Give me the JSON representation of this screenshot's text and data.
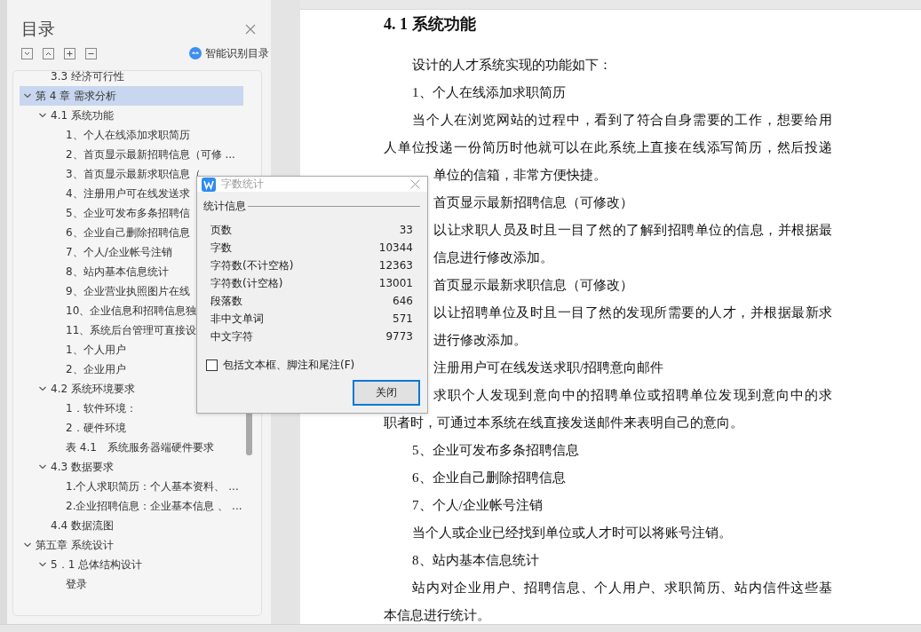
{
  "toc_panel": {
    "title": "目录",
    "smart_button": "智能识别目录",
    "tree": [
      {
        "label": "3.3 经济可行性",
        "kind": "orphan",
        "selected": false
      },
      {
        "label": "第 4 章  需求分析",
        "selected": true,
        "expanded": true,
        "children": [
          {
            "label": "4.1 系统功能",
            "selected": false,
            "expanded": true,
            "children": [
              {
                "label": "1、个人在线添加求职简历",
                "selected": false
              },
              {
                "label": "2、首页显示最新招聘信息（可修 ...",
                "selected": false
              },
              {
                "label": "3、首页显示最新求职信息（",
                "selected": false
              },
              {
                "label": "4、注册用户可在线发送求",
                "selected": false
              },
              {
                "label": "5、企业可发布多条招聘信",
                "selected": false
              },
              {
                "label": "6、企业自己删除招聘信息",
                "selected": false
              },
              {
                "label": "7、个人/企业帐号注销",
                "selected": false
              },
              {
                "label": "8、站内基本信息统计",
                "selected": false
              },
              {
                "label": "9、企业营业执照图片在线",
                "selected": false
              },
              {
                "label": "10、企业信息和招聘信息独",
                "selected": false
              },
              {
                "label": "11、系统后台管理可直接设",
                "selected": false
              },
              {
                "label": "1、个人用户",
                "selected": false
              },
              {
                "label": "2、企业用户",
                "selected": false
              }
            ]
          },
          {
            "label": "4.2 系统环境要求",
            "selected": false,
            "expanded": true,
            "children": [
              {
                "label": "1．软件环境：",
                "selected": false
              },
              {
                "label": "2．硬件环境",
                "selected": false
              },
              {
                "label": "表 4.1　系统服务器端硬件要求",
                "selected": false
              }
            ]
          },
          {
            "label": "4.3 数据要求",
            "selected": false,
            "expanded": true,
            "children": [
              {
                "label": "1.个人求职简历：个人基本资料、 ...",
                "selected": false
              },
              {
                "label": "2.企业招聘信息：企业基本信息 、 ...",
                "selected": false
              }
            ]
          },
          {
            "label": "4.4 数据流图",
            "selected": false
          }
        ]
      },
      {
        "label": "第五章  系统设计",
        "selected": false,
        "expanded": true,
        "children": [
          {
            "label": "5．1 总体结构设计",
            "selected": false,
            "expanded": true,
            "children": [
              {
                "label": "登录",
                "selected": false
              }
            ]
          }
        ]
      }
    ]
  },
  "document": {
    "lines": [
      {
        "kind": "heading",
        "text": "4. 1 系统功能"
      },
      {
        "kind": "indent",
        "text": "设计的人才系统实现的功能如下："
      },
      {
        "kind": "indent",
        "text": "1、个人在线添加求职简历"
      },
      {
        "kind": "indent-full",
        "text": "当个人在浏览网站的过程中，看到了符合自身需要的工作，想要给用"
      },
      {
        "kind": "line-full",
        "text": "人单位投递一份简历时他就可以在此系统上直接在线添写简历，然后投递"
      },
      {
        "kind": "after",
        "text": "单位的信箱，非常方便快捷。"
      },
      {
        "kind": "after",
        "text": "首页显示最新招聘信息（可修改）"
      },
      {
        "kind": "after-full",
        "text": "以让求职人员及时且一目了然的了解到招聘单位的信息，并根据最"
      },
      {
        "kind": "after",
        "text": "信息进行修改添加。"
      },
      {
        "kind": "after",
        "text": "首页显示最新求职信息（可修改）"
      },
      {
        "kind": "after-full",
        "text": "以让招聘单位及时且一目了然的发现所需要的人才，并根据最新求"
      },
      {
        "kind": "after",
        "text": "进行修改添加。"
      },
      {
        "kind": "after",
        "text": "注册用户可在线发送求职/招聘意向邮件"
      },
      {
        "kind": "after-full",
        "text": "求职个人发现到意向中的招聘单位或招聘单位发现到意向中的求"
      },
      {
        "kind": "line",
        "text": "职者时，可通过本系统在线直接发送邮件来表明自己的意向。"
      },
      {
        "kind": "indent",
        "text": "5、企业可发布多条招聘信息"
      },
      {
        "kind": "indent",
        "text": "6、企业自己删除招聘信息"
      },
      {
        "kind": "indent",
        "text": "7、个人/企业帐号注销"
      },
      {
        "kind": "indent",
        "text": "当个人或企业已经找到单位或人才时可以将账号注销。"
      },
      {
        "kind": "indent",
        "text": "8、站内基本信息统计"
      },
      {
        "kind": "indent-full",
        "text": "站内对企业用户、招聘信息、个人用户、求职简历、站内信件这些基"
      },
      {
        "kind": "line",
        "text": "本信息进行统计。"
      }
    ]
  },
  "dialog": {
    "title": "字数统计",
    "group": "统计信息",
    "stats": [
      {
        "label": "页数",
        "value": "33"
      },
      {
        "label": "字数",
        "value": "10344"
      },
      {
        "label": "字符数(不计空格)",
        "value": "12363"
      },
      {
        "label": "字符数(计空格)",
        "value": "13001"
      },
      {
        "label": "段落数",
        "value": "646"
      },
      {
        "label": "非中文单词",
        "value": "571"
      },
      {
        "label": "中文字符",
        "value": "9773"
      }
    ],
    "include_checkbox": {
      "label": "包括文本框、脚注和尾注(F)",
      "checked": false
    },
    "close_button": "关闭"
  }
}
